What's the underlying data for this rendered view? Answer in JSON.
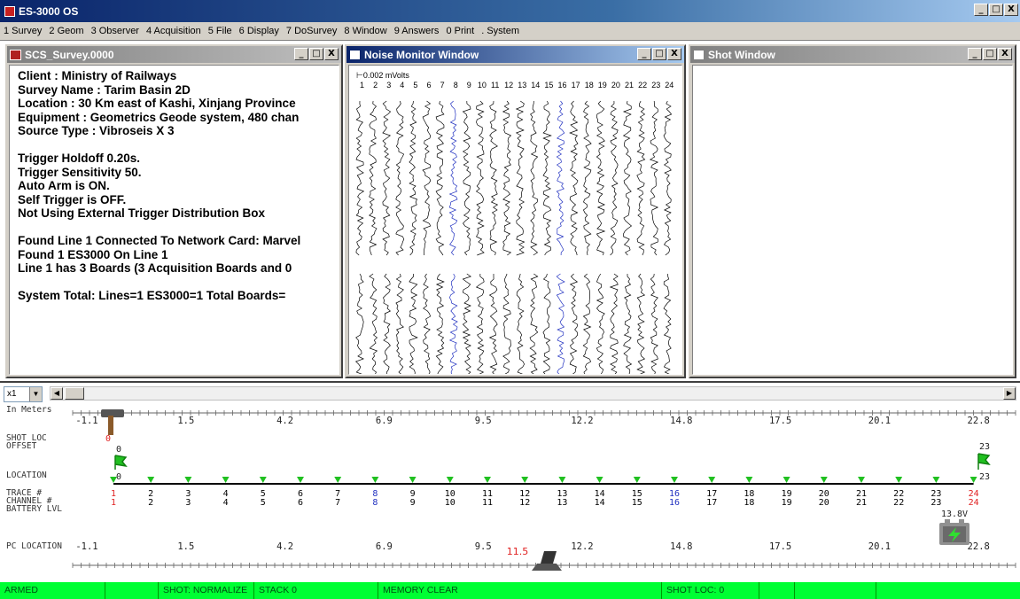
{
  "app": {
    "title": "ES-3000 OS"
  },
  "menu": [
    "1 Survey",
    "2 Geom",
    "3 Observer",
    "4 Acquisition",
    "5 File",
    "6 Display",
    "7 DoSurvey",
    "8 Window",
    "9 Answers",
    "0 Print",
    ". System"
  ],
  "window_buttons": {
    "minimize": "_",
    "maximize": "□",
    "close": "X"
  },
  "survey_window": {
    "title": "SCS_Survey.0000",
    "lines": [
      "Client : Ministry of Railways",
      "Survey Name  : Tarim Basin 2D",
      "Location  : 30 Km east of Kashi, Xinjang Province",
      "Equipment  : Geometrics Geode system, 480 chan",
      "Source Type  : Vibroseis X 3",
      "",
      "Trigger Holdoff 0.20s.",
      "Trigger Sensitivity 50.",
      "Auto Arm is ON.",
      "Self Trigger is OFF.",
      "Not Using External Trigger Distribution Box",
      "",
      "Found Line 1 Connected To Network Card: Marvel",
      "Found 1 ES3000 On Line 1",
      "Line 1 has 3 Boards (3 Acquisition Boards and 0",
      "",
      "System Total: Lines=1  ES3000=1  Total Boards="
    ]
  },
  "noise_window": {
    "title": "Noise Monitor Window",
    "scale_label": "0.002 mVolts",
    "channels": [
      "1",
      "2",
      "3",
      "4",
      "5",
      "6",
      "7",
      "8",
      "9",
      "10",
      "11",
      "12",
      "13",
      "14",
      "15",
      "16",
      "17",
      "18",
      "19",
      "20",
      "21",
      "22",
      "23",
      "24"
    ],
    "highlighted_channels": [
      8,
      16
    ],
    "trace_color": "#000000",
    "highlight_color": "#2030c0"
  },
  "shot_window": {
    "title": "Shot Window"
  },
  "spread": {
    "zoom": "x1",
    "units_label": "In Meters",
    "ticks": [
      "-1.1",
      "1.5",
      "4.2",
      "6.9",
      "9.5",
      "12.2",
      "14.8",
      "17.5",
      "20.1",
      "22.8"
    ],
    "labels": {
      "shot_loc": "SHOT LOC",
      "offset": "OFFSET",
      "location": "LOCATION",
      "trace": "TRACE #",
      "channel": "CHANNEL #",
      "battery": "BATTERY LVL",
      "pc_location": "PC LOCATION"
    },
    "shot_location_value": "0",
    "left_flag": {
      "offset": "0",
      "location": "0"
    },
    "right_flag": {
      "offset": "23",
      "location": "23"
    },
    "traces": [
      "1",
      "2",
      "3",
      "4",
      "5",
      "6",
      "7",
      "8",
      "9",
      "10",
      "11",
      "12",
      "13",
      "14",
      "15",
      "16",
      "17",
      "18",
      "19",
      "20",
      "21",
      "22",
      "23",
      "24"
    ],
    "channels": [
      "1",
      "2",
      "3",
      "4",
      "5",
      "6",
      "7",
      "8",
      "9",
      "10",
      "11",
      "12",
      "13",
      "14",
      "15",
      "16",
      "17",
      "18",
      "19",
      "20",
      "21",
      "22",
      "23",
      "24"
    ],
    "battery_level": "13.8V",
    "pc_location_value": "11.5",
    "colors": {
      "trace_default": "#000000",
      "trace_red": "#e02020",
      "trace_blue": "#2030c0",
      "geophone": "#20c020"
    }
  },
  "status": {
    "armed": "ARMED",
    "shot_mode": "SHOT: NORMALIZE",
    "stack": "STACK 0",
    "memory": "MEMORY CLEAR",
    "shot_loc": "SHOT LOC: 0",
    "background": "#00ff33"
  }
}
